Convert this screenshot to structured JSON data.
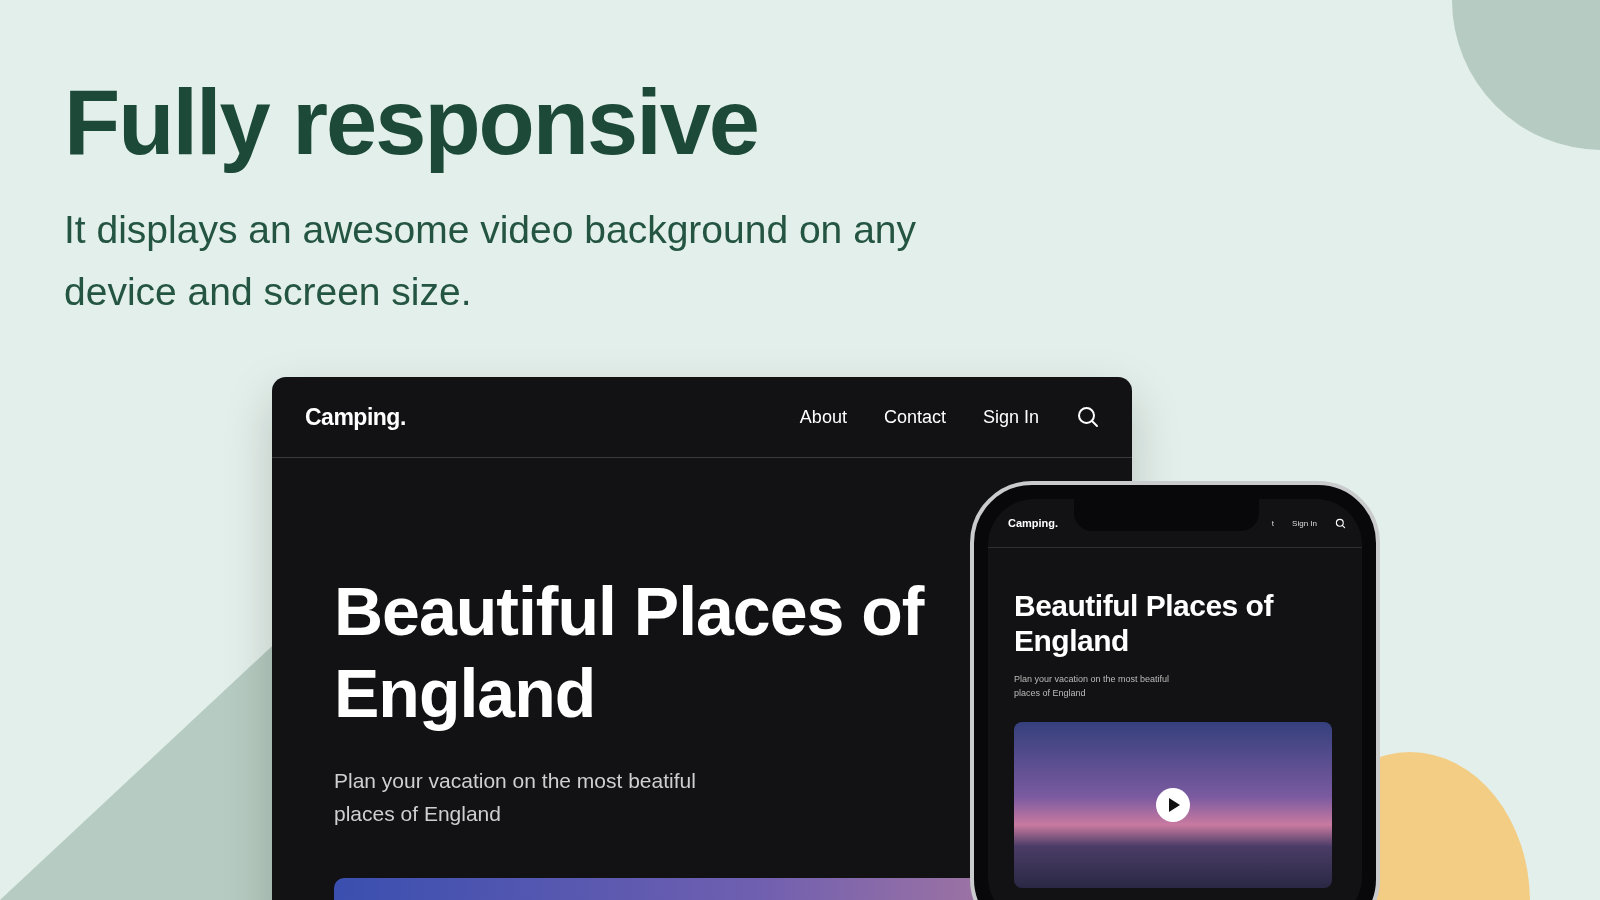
{
  "heading": "Fully responsive",
  "subheading": "It displays an awesome video background on any device and screen size.",
  "desktop": {
    "logo": "Camping.",
    "nav": [
      "About",
      "Contact",
      "Sign In"
    ],
    "title": "Beautiful Places of England",
    "description": "Plan your vacation on the most beatiful places of England"
  },
  "phone": {
    "logo": "Camping.",
    "nav": [
      "t",
      "Sign In"
    ],
    "title": "Beautiful Places of England",
    "description": "Plan your vacation on the most beatiful places of England"
  }
}
